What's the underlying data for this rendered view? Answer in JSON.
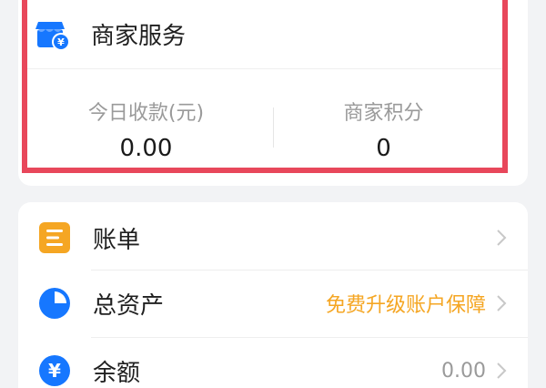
{
  "merchant": {
    "title": "商家服务",
    "icon": "shop-icon",
    "stats": [
      {
        "label": "今日收款(元)",
        "value": "0.00"
      },
      {
        "label": "商家积分",
        "value": "0"
      }
    ]
  },
  "menu": {
    "items": [
      {
        "label": "账单",
        "icon": "bill-list-icon",
        "extra": "",
        "extra_color": ""
      },
      {
        "label": "总资产",
        "icon": "pie-chart-icon",
        "extra": "免费升级账户保障",
        "extra_color": "#f5a623"
      },
      {
        "label": "余额",
        "icon": "yuan-coin-icon",
        "extra": "0.00",
        "extra_color": "#9a9a9a"
      }
    ]
  },
  "colors": {
    "highlight": "#e8475b",
    "primary_blue": "#1677ff",
    "orange": "#f5a623"
  }
}
